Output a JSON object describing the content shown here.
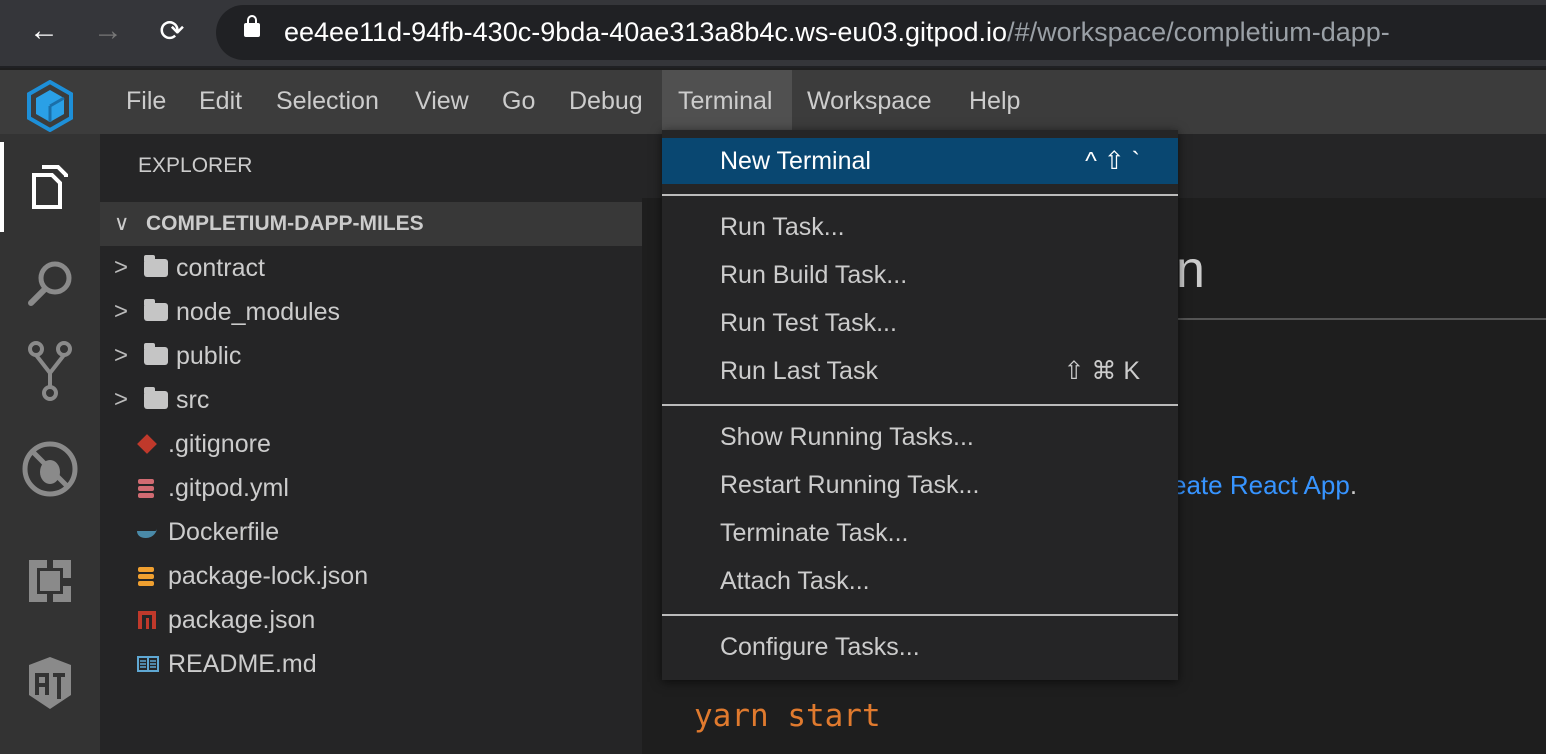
{
  "browser": {
    "url_host": "ee4ee11d-94fb-430c-9bda-40ae313a8b4c.ws-eu03.gitpod.io",
    "url_path": "/#/workspace/completium-dapp-"
  },
  "menubar": {
    "items": [
      "File",
      "Edit",
      "Selection",
      "View",
      "Go",
      "Debug",
      "Terminal",
      "Workspace",
      "Help"
    ],
    "open": "Terminal"
  },
  "sidebar": {
    "title": "EXPLORER",
    "section": "COMPLETIUM-DAPP-MILES",
    "folders": [
      "contract",
      "node_modules",
      "public",
      "src"
    ],
    "files": [
      ".gitignore",
      ".gitpod.yml",
      "Dockerfile",
      "package-lock.json",
      "package.json",
      "README.md"
    ]
  },
  "terminal_menu": {
    "new_terminal": {
      "label": "New Terminal",
      "shortcut": "^ ⇧ `"
    },
    "run_task": "Run Task...",
    "run_build_task": "Run Build Task...",
    "run_test_task": "Run Test Task...",
    "run_last_task": {
      "label": "Run Last Task",
      "shortcut": "⇧ ⌘ K"
    },
    "show_running_tasks": "Show Running Tasks...",
    "restart_running_task": "Restart Running Task...",
    "terminate_task": "Terminate Task...",
    "attach_task": "Attach Task...",
    "configure_tasks": "Configure Tasks..."
  },
  "editor": {
    "heading_fragment": "n",
    "link_fragment": "eate React App",
    "link_suffix": ".",
    "code": "yarn start"
  },
  "colors": {
    "accent": "#094771",
    "link": "#3794ff",
    "code": "#e07a2e"
  }
}
